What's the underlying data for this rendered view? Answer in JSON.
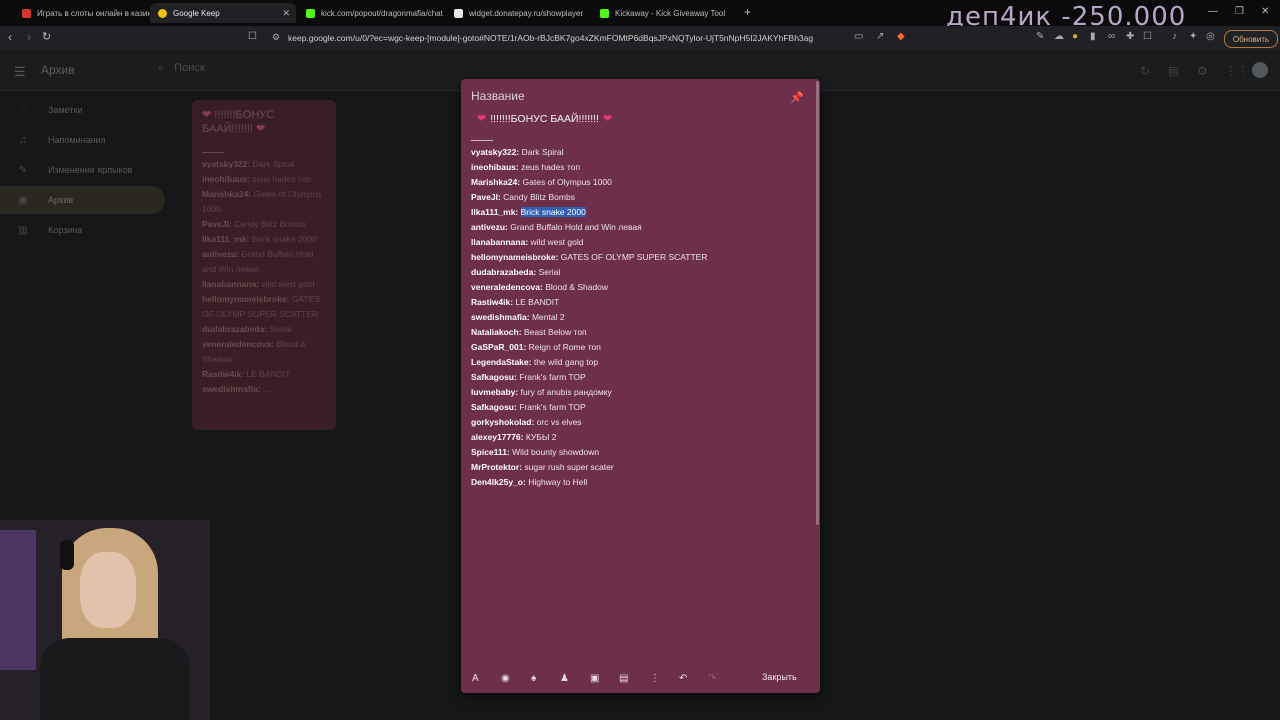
{
  "browser": {
    "tabs": [
      {
        "label": "Играть в слоты онлайн в казино",
        "favicon_color": "#d8342f",
        "active": false
      },
      {
        "label": "Google Keep",
        "favicon_color": "#f4c20d",
        "active": true
      },
      {
        "label": "kick.com/popout/dragonmafia/chat",
        "favicon_color": "#53fc18",
        "active": false
      },
      {
        "label": "widget.donatepay.ru/showplayer",
        "favicon_color": "#e8e8e8",
        "active": false
      },
      {
        "label": "Kickaway - Kick Giveaway Tool",
        "favicon_color": "#53fc18",
        "active": false
      }
    ],
    "url": "keep.google.com/u/0/?ec=wgc-keep-[module]-goto#NOTE/1rAOb-rBJcBK7go4xZKmFOMtP6dBqsJPxNQTylor-UjT5nNpH5I2JAKYhFBh3ag",
    "update_label": "Обновить",
    "overlay_text": "деп4ик -250.000"
  },
  "keep": {
    "app_title": "Архив",
    "search_placeholder": "Поиск",
    "sidebar": [
      {
        "label": "Заметки",
        "icon": "lightbulb-icon"
      },
      {
        "label": "Напоминания",
        "icon": "bell-icon"
      },
      {
        "label": "Изменение ярлыков",
        "icon": "pencil-icon"
      },
      {
        "label": "Архив",
        "icon": "archive-icon"
      },
      {
        "label": "Корзина",
        "icon": "trash-icon"
      }
    ],
    "background_note": {
      "title": "!!!!!!!БОНУС БААЙ!!!!!!!",
      "rows": [
        {
          "user": "vyatsky322:",
          "text": "Dark Spiral"
        },
        {
          "user": "ineohibaus:",
          "text": "zeus hades топ"
        },
        {
          "user": "Marishka24:",
          "text": "Gates of Olympus 1000"
        },
        {
          "user": "PaveJI:",
          "text": "Candy Blitz Bombs"
        },
        {
          "user": "Ilka111_mk:",
          "text": "Brick snake 2000"
        },
        {
          "user": "antivezu:",
          "text": "Grand Buffalo Hold and Win левая"
        },
        {
          "user": "llanabannana:",
          "text": "wild west gold"
        },
        {
          "user": "hellomynameisbroke:",
          "text": "GATES OF OLYMP SUPER SCATTER"
        },
        {
          "user": "dudabrazabeda:",
          "text": "Serial"
        },
        {
          "user": "veneraledencova:",
          "text": "Blood & Shadow"
        },
        {
          "user": "Rastiw4ik:",
          "text": "LE BANDIT"
        },
        {
          "user": "swedishmafia:",
          "text": "..."
        }
      ]
    },
    "dialog": {
      "title_placeholder": "Название",
      "heading": "!!!!!!!БОНУС БААЙ!!!!!!!",
      "close_label": "Закрыть",
      "entries": [
        {
          "user": "vyatsky322:",
          "text": "Dark Spiral"
        },
        {
          "user": "ineohibaus:",
          "text": "zeus hades топ"
        },
        {
          "user": "Marishka24:",
          "text": "Gates of Olympus 1000"
        },
        {
          "user": "PaveJI:",
          "text": "Candy Blitz Bombs"
        },
        {
          "user": "Ilka111_mk:",
          "text": "Brick snake 2000",
          "selected": true
        },
        {
          "user": "antivezu:",
          "text": "Grand Buffalo Hold and Win левая"
        },
        {
          "user": "llanabannana:",
          "text": "wild west gold"
        },
        {
          "user": "hellomynameisbroke:",
          "text": "GATES OF OLYMP SUPER SCATTER"
        },
        {
          "user": "dudabrazabeda:",
          "text": "Serial"
        },
        {
          "user": "veneraledencova:",
          "text": "Blood & Shadow"
        },
        {
          "user": "Rastiw4ik:",
          "text": "LE BANDIT"
        },
        {
          "user": "swedishmafia:",
          "text": "Mental 2"
        },
        {
          "user": "Nataliakoch:",
          "text": "Beast Below топ"
        },
        {
          "user": "GaSPaR_001:",
          "text": "Reign of Rome топ"
        },
        {
          "user": "LegendaStake:",
          "text": "the wild gang top"
        },
        {
          "user": "Safkagosu:",
          "text": "Frank's farm TOP"
        },
        {
          "user": "luvmebaby:",
          "text": "fury of anubis рандомку"
        },
        {
          "user": "Safkagosu:",
          "text": "Frank's farm TOP"
        },
        {
          "user": "gorkyshokolad:",
          "text": "orc vs elves"
        },
        {
          "user": "alexey17776:",
          "text": "КУБЫ 2"
        },
        {
          "user": "Spice111:",
          "text": "Wild bounty showdown"
        },
        {
          "user": "MrProtektor:",
          "text": "sugar rush super scater"
        },
        {
          "user": "Den4lk25y_o:",
          "text": "Highway to Hell"
        }
      ]
    }
  }
}
